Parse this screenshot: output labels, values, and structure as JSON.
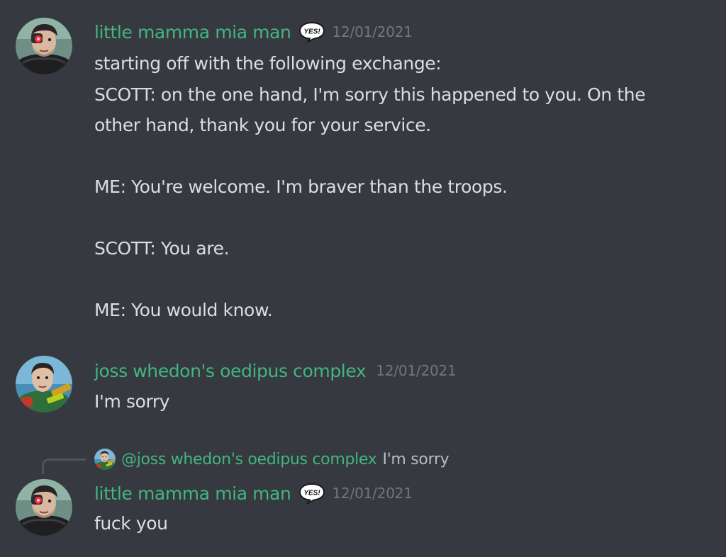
{
  "messages": [
    {
      "username": "little mamma mia man",
      "badge": "YES!",
      "timestamp": "12/01/2021",
      "lines": [
        "starting off with the following exchange:",
        "SCOTT: on the one hand, I'm sorry this happened to you. On the",
        "other hand, thank you for your service.",
        "",
        "ME: You're welcome. I'm braver than the troops.",
        "",
        "SCOTT: You are.",
        "",
        "ME: You would know."
      ]
    },
    {
      "username": "joss whedon's oedipus complex",
      "timestamp": "12/01/2021",
      "lines": [
        "I'm sorry"
      ]
    },
    {
      "reply": {
        "mention": "@joss whedon's oedipus complex",
        "text": "I'm sorry"
      },
      "username": "little mamma mia man",
      "badge": "YES!",
      "timestamp": "12/01/2021",
      "lines": [
        "fuck you"
      ]
    }
  ],
  "colors": {
    "background": "#36393f",
    "username": "#43b581",
    "text": "#dcddde",
    "timestamp": "#72767d"
  },
  "icons": {
    "avatar_1": "cyborg-man-avatar-icon",
    "avatar_2": "man-with-weapon-avatar-icon",
    "badge": "yes-speech-bubble-icon"
  }
}
